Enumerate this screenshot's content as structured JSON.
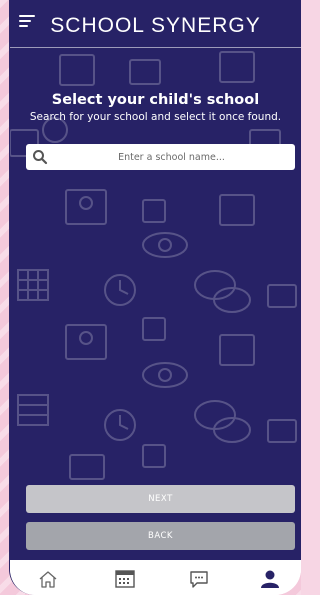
{
  "header": {
    "brand": "SCHOOL SYNERGY"
  },
  "main": {
    "heading": "Select your child's school",
    "subheading": "Search for your school and select it once found.",
    "search": {
      "placeholder": "Enter a school name...",
      "value": ""
    },
    "next_label": "NEXT",
    "back_label": "BACK"
  },
  "tabbar": {
    "items": [
      "home-icon",
      "calendar-icon",
      "chat-icon",
      "profile-icon"
    ],
    "active": "profile-icon"
  },
  "colors": {
    "background": "#272266",
    "next_button": "#c5c5c9",
    "back_button": "#a3a5ab"
  }
}
